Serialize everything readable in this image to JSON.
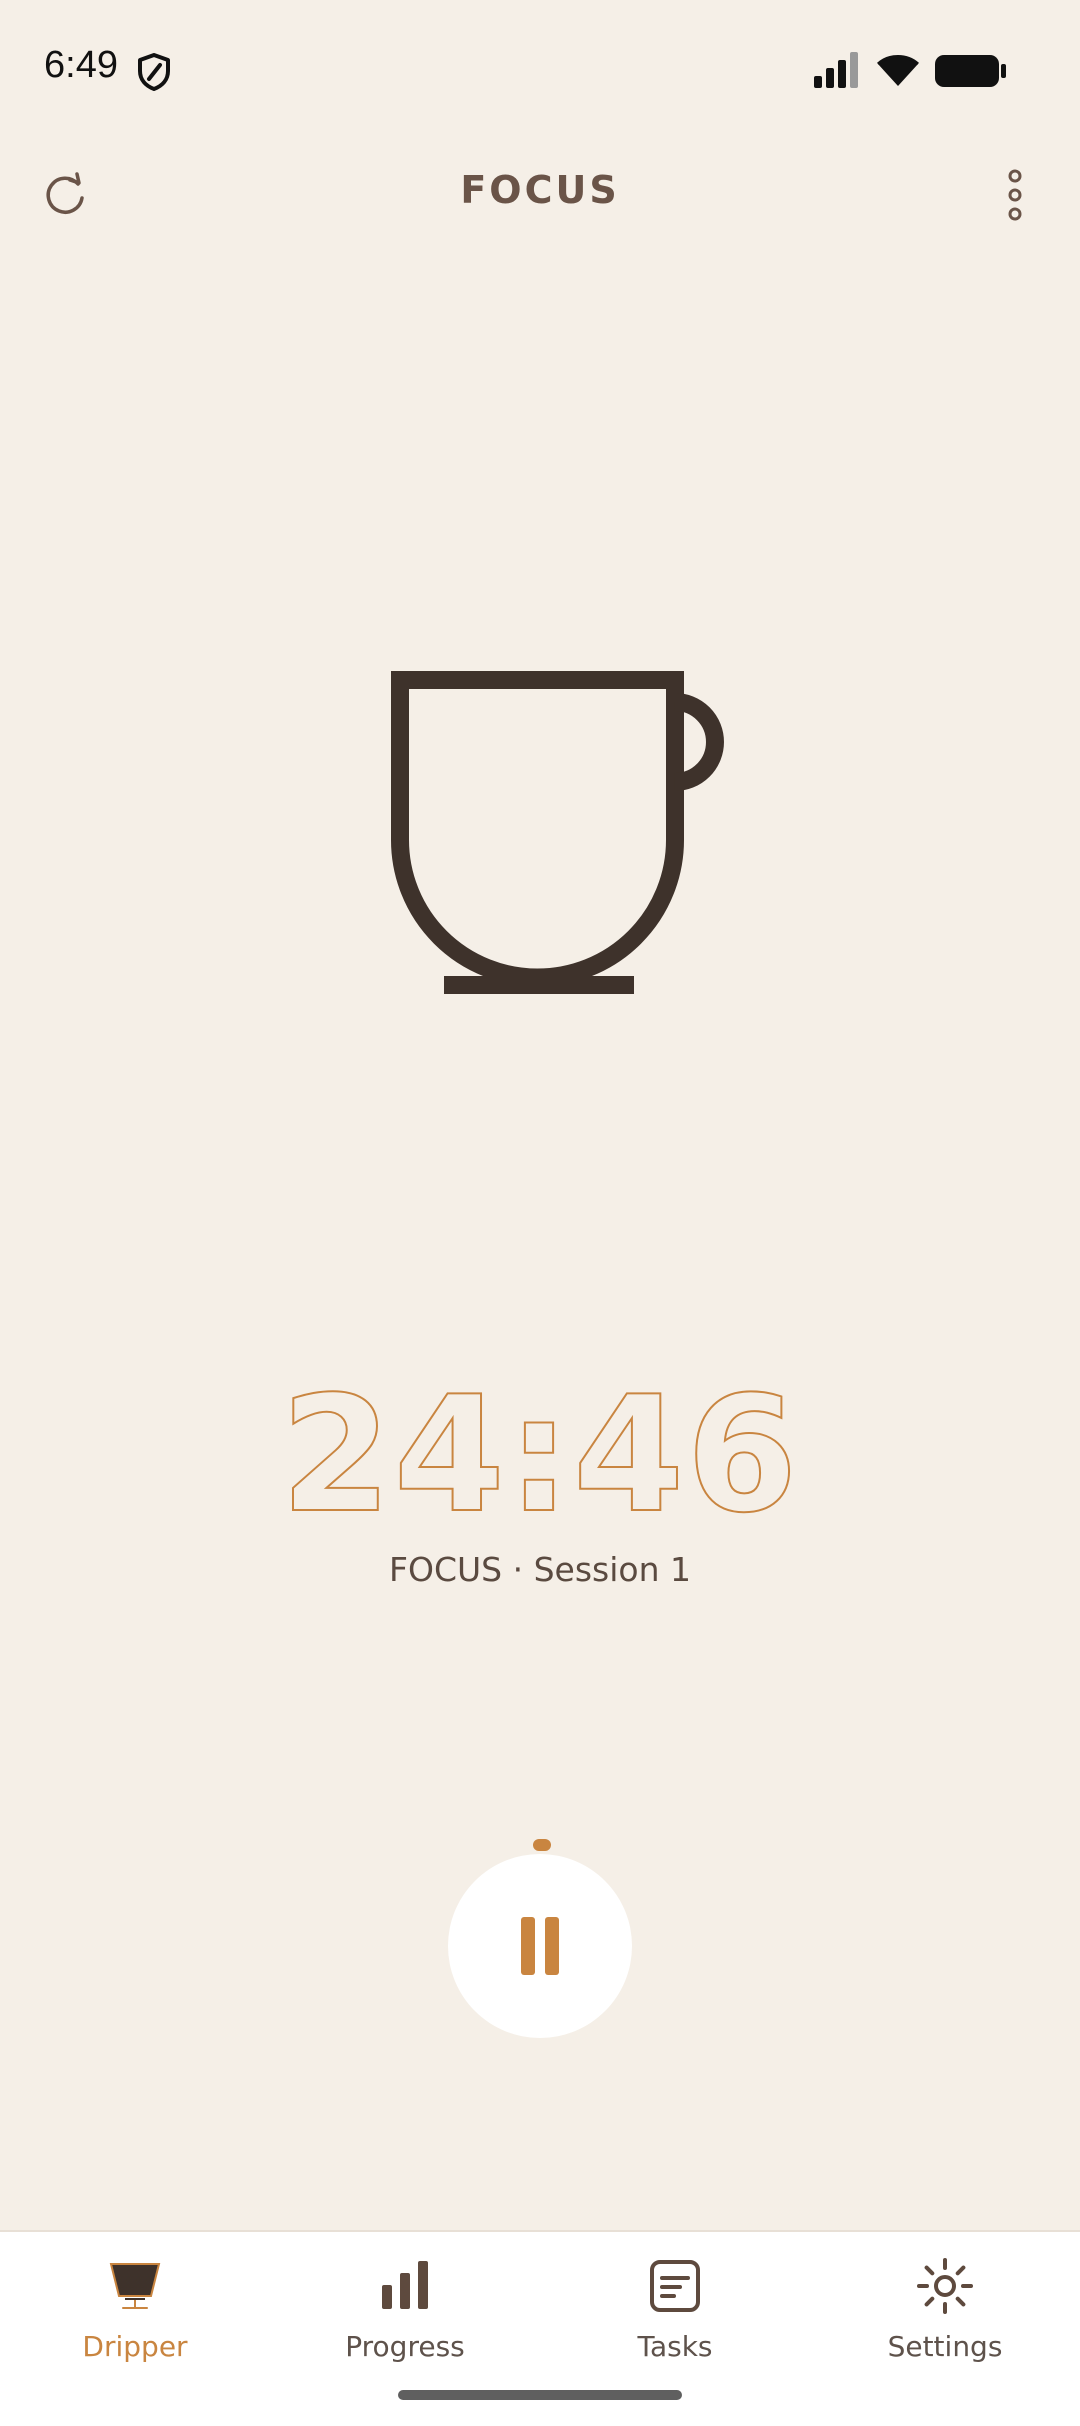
{
  "status_bar": {
    "time": "6:49",
    "icons": [
      "shield-icon",
      "cellular-signal-icon",
      "wifi-icon",
      "battery-icon"
    ]
  },
  "header": {
    "title": "FOCUS",
    "left_icon": "refresh-icon",
    "right_icon": "more-vertical-icon"
  },
  "main": {
    "illustration": "coffee-cup-icon",
    "timer": "24:46",
    "session_label": "FOCUS · Session 1",
    "control_icon": "pause-icon"
  },
  "bottom_nav": {
    "items": [
      {
        "label": "Dripper",
        "icon": "dripper-icon",
        "active": true
      },
      {
        "label": "Progress",
        "icon": "bar-chart-icon",
        "active": false
      },
      {
        "label": "Tasks",
        "icon": "tasks-icon",
        "active": false
      },
      {
        "label": "Settings",
        "icon": "sun-icon",
        "active": false
      }
    ]
  },
  "colors": {
    "background": "#F5EFE7",
    "accent": "#C98540",
    "dark_brown": "#3E322B",
    "title_brown": "#6A5448",
    "nav_background": "#FFFFFF"
  }
}
